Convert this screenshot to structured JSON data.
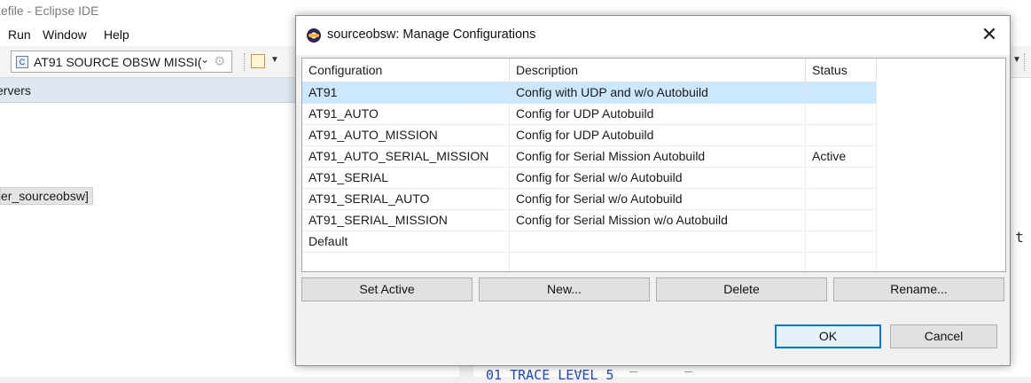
{
  "ide": {
    "window_title": "kefile - Eclipse IDE",
    "menu": [
      "Run",
      "Window",
      "Help"
    ],
    "config_combo_value": "AT91 SOURCE OBSW MISSI(",
    "left_tab_label": "ervers",
    "left_item": "er_sourceobsw]",
    "editor_fragment": "o t",
    "editor_bottom_text": "01 TRACE LEVEL  5",
    "editor_underscores": "_ _ _"
  },
  "dialog": {
    "title": "sourceobsw: Manage Configurations",
    "close_glyph": "✕",
    "columns": [
      "Configuration",
      "Description",
      "Status"
    ],
    "rows": [
      {
        "configuration": "AT91",
        "description": "Config with UDP and w/o Autobuild",
        "status": ""
      },
      {
        "configuration": "AT91_AUTO",
        "description": "Config for UDP Autobuild",
        "status": ""
      },
      {
        "configuration": "AT91_AUTO_MISSION",
        "description": "Config for UDP Autobuild",
        "status": ""
      },
      {
        "configuration": "AT91_AUTO_SERIAL_MISSION",
        "description": "Config for Serial Mission Autobuild",
        "status": "Active"
      },
      {
        "configuration": "AT91_SERIAL",
        "description": "Config for Serial w/o Autobuild",
        "status": ""
      },
      {
        "configuration": "AT91_SERIAL_AUTO",
        "description": "Config for Serial w/o Autobuild",
        "status": ""
      },
      {
        "configuration": "AT91_SERIAL_MISSION",
        "description": "Config for Serial Mission w/o Autobuild",
        "status": ""
      },
      {
        "configuration": "Default",
        "description": "",
        "status": ""
      },
      {
        "configuration": "",
        "description": "",
        "status": ""
      }
    ],
    "selected_row": 0,
    "action_buttons": {
      "set_active": "Set Active",
      "new": "New...",
      "delete": "Delete",
      "rename": "Rename..."
    },
    "ok_label": "OK",
    "cancel_label": "Cancel",
    "colors": {
      "selection": "#cce8ff",
      "default_button_border": "#0078d7"
    }
  }
}
